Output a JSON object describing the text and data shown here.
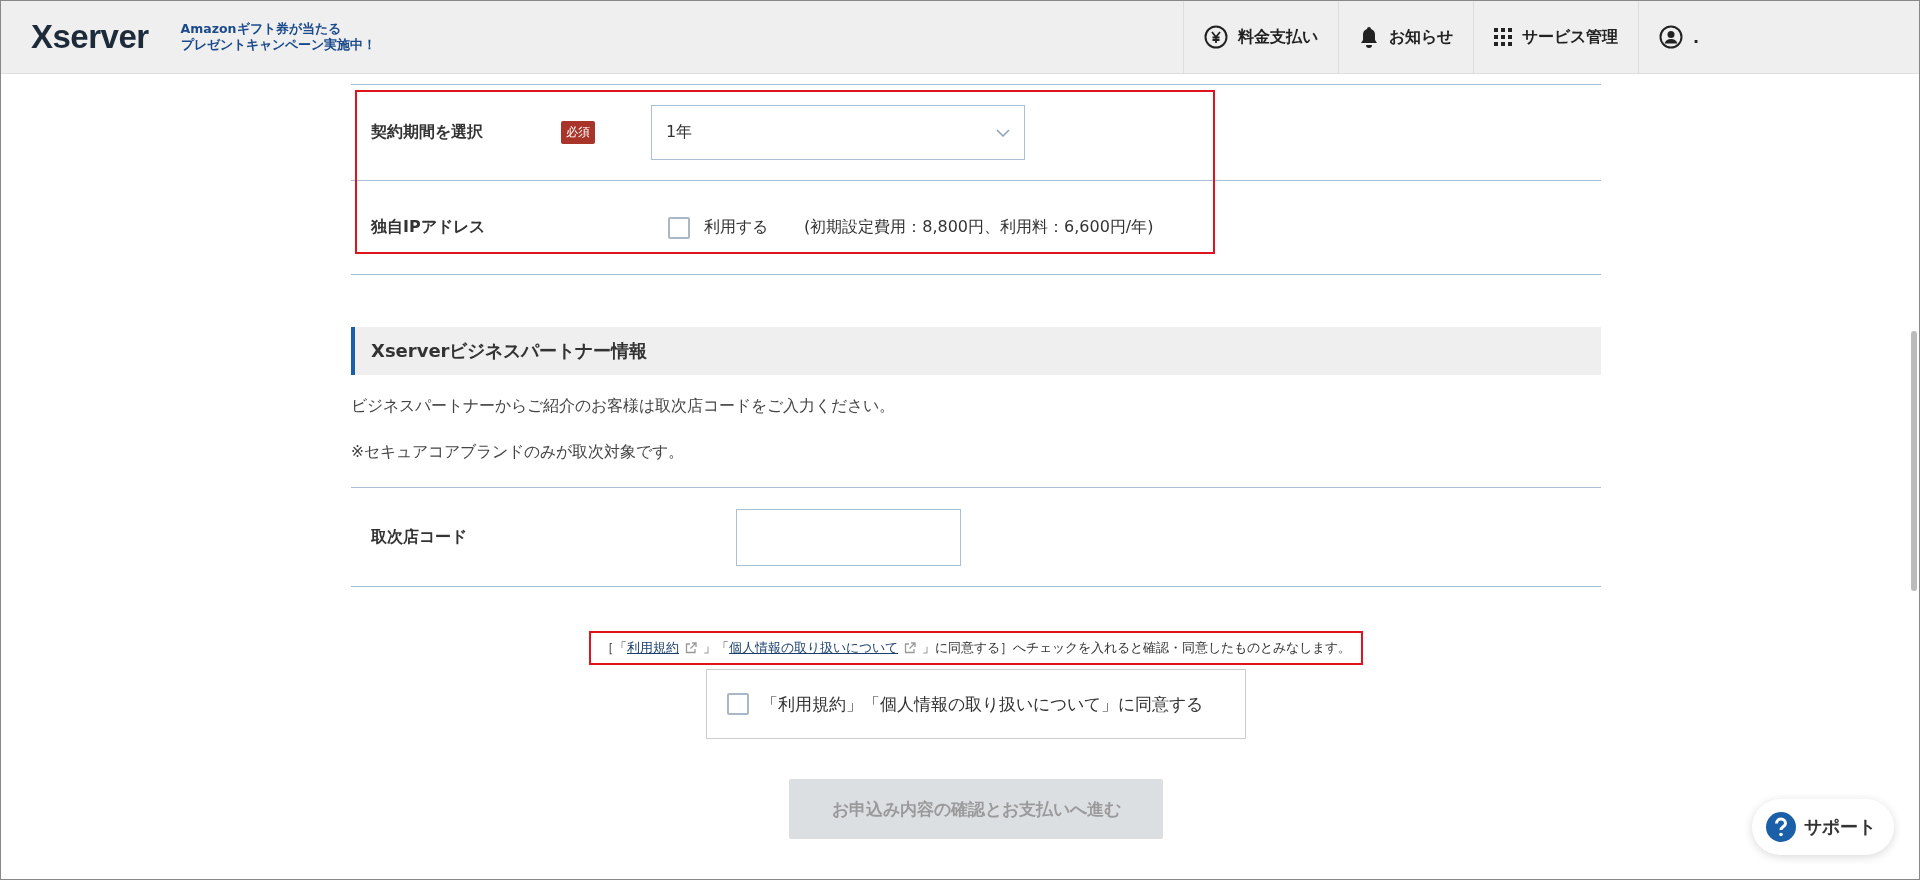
{
  "header": {
    "logo": "Xserver",
    "promo": [
      "Amazonギフト券が当たる",
      "プレゼントキャンペーン実施中！"
    ],
    "nav": [
      {
        "kind": "yen",
        "label": "料金支払い"
      },
      {
        "kind": "bell",
        "label": "お知らせ"
      },
      {
        "kind": "grid",
        "label": "サービス管理"
      },
      {
        "kind": "user",
        "label": "."
      }
    ]
  },
  "contract": {
    "period": {
      "label": "契約期間を選択",
      "badge": "必須",
      "value": "1年"
    },
    "ip": {
      "label": "独自IPアドレス",
      "option": "利用する",
      "checked": false,
      "note": "(初期設定費用：8,800円、利用料：6,600円/年)"
    }
  },
  "partner": {
    "title": "Xserverビジネスパートナー情報",
    "texts": [
      "ビジネスパートナーからご紹介のお客様は取次店コードをご入力ください。",
      "※セキュアコアブランドのみが取次対象です。"
    ],
    "code_label": "取次店コード"
  },
  "notice": [
    {
      "kind": "text",
      "text": "［「"
    },
    {
      "kind": "link",
      "text": "利用規約"
    },
    {
      "kind": "text",
      "text": "」「"
    },
    {
      "kind": "link",
      "text": "個人情報の取り扱いについて"
    },
    {
      "kind": "text",
      "text": "」に同意する］へチェックを入れると確認・同意したものとみなします。"
    }
  ],
  "agree": {
    "label": "「利用規約」「個人情報の取り扱いについて」に同意する",
    "checked": false
  },
  "submit": {
    "label": "お申込み内容の確認とお支払いへ進む",
    "disabled": true
  },
  "support": {
    "label": "サポート"
  }
}
